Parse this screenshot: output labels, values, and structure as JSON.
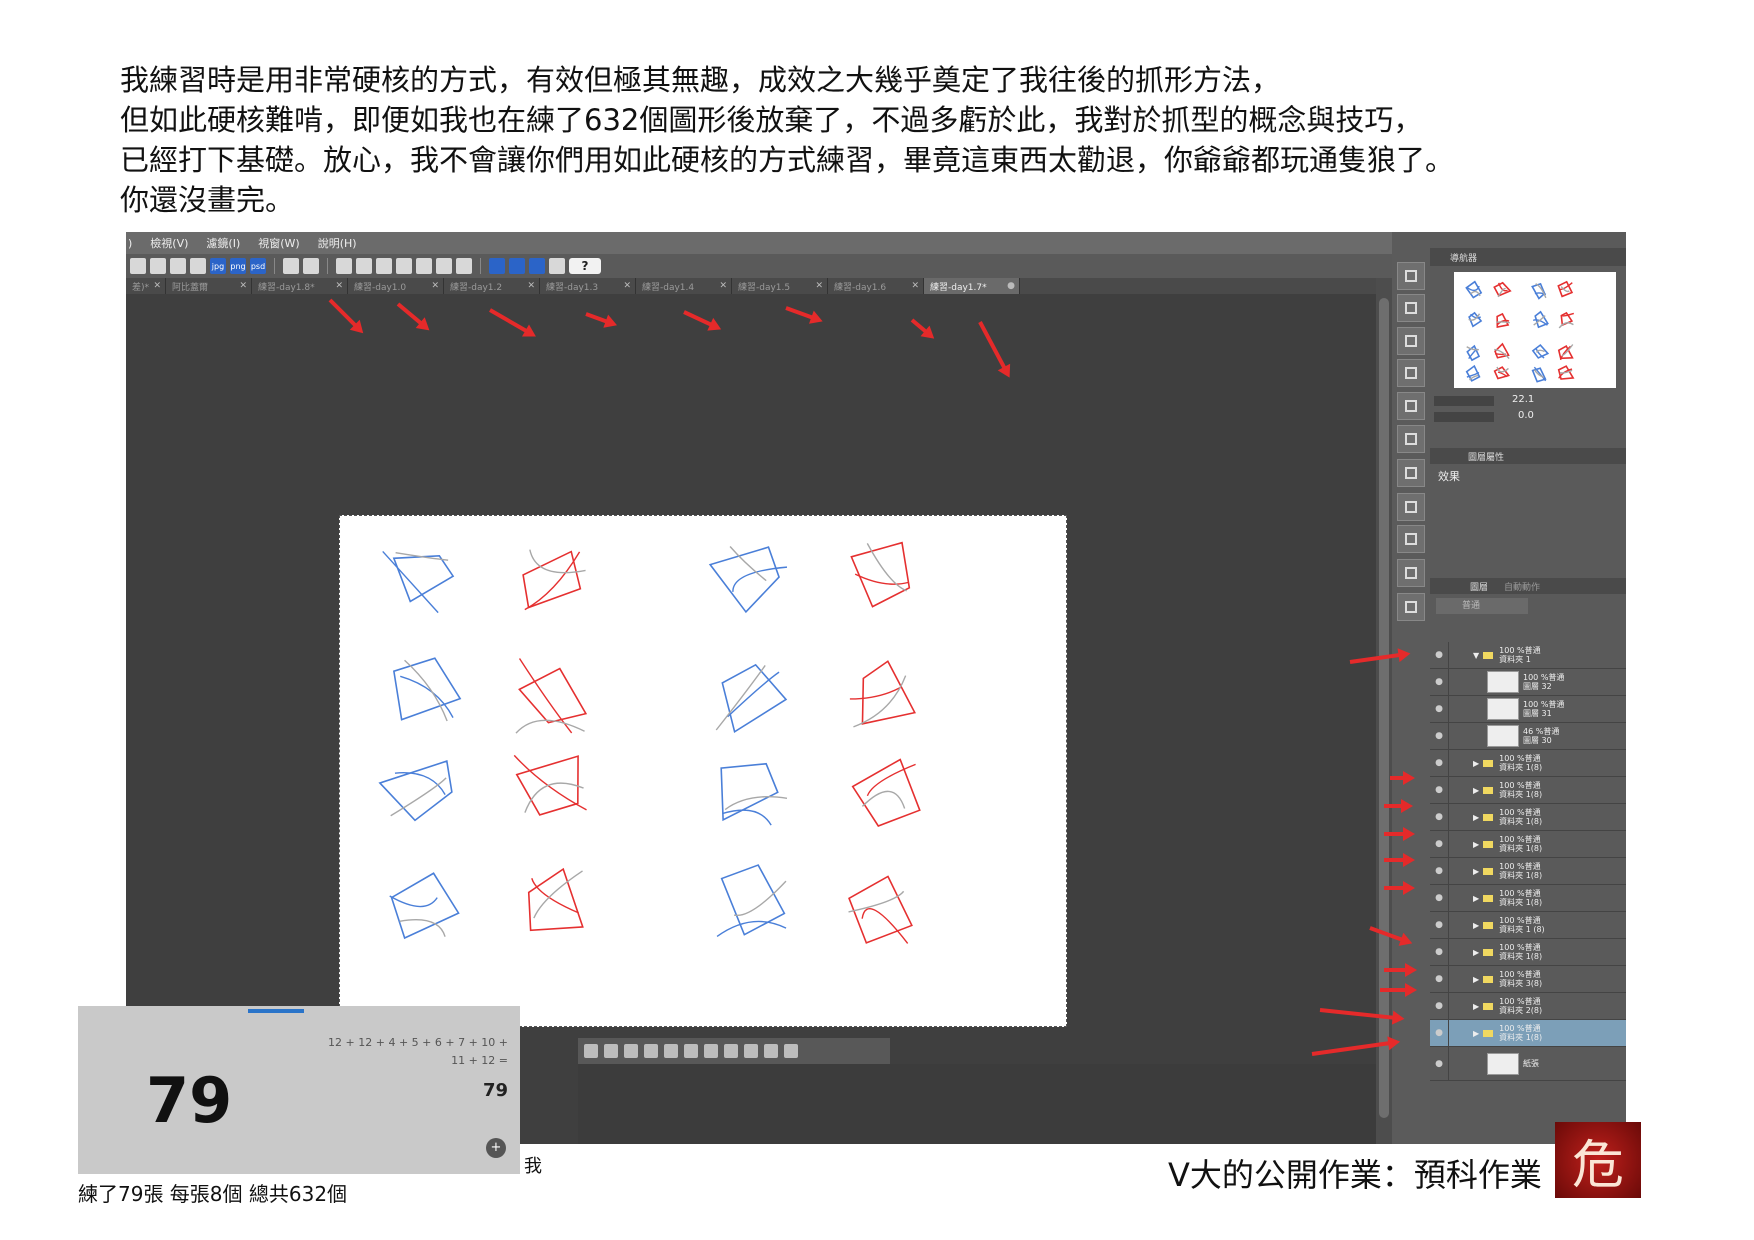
{
  "intro": {
    "line1": "我練習時是用非常硬核的方式，有效但極其無趣，成效之大幾乎奠定了我往後的抓形方法，",
    "line2": "但如此硬核難啃，即便如我也在練了632個圖形後放棄了，不過多虧於此，我對於抓型的概念與技巧，",
    "line3": "已經打下基礎。放心，我不會讓你們用如此硬核的方式練習，畢竟這東西太勸退，你爺爺都玩通隻狼了。",
    "line4": "你還沒畫完。"
  },
  "menu": [
    ")",
    "檢視(V)",
    "濾鏡(I)",
    "視窗(W)",
    "說明(H)"
  ],
  "toolbar_labels": {
    "jpg": "jpg",
    "png": "png",
    "psd": "psd",
    "help": "?"
  },
  "tabs": [
    {
      "label": "差)*",
      "active": false
    },
    {
      "label": "阿比蓋爾",
      "active": false
    },
    {
      "label": "練習-day1.8*",
      "active": false
    },
    {
      "label": "練習-day1.0",
      "active": false
    },
    {
      "label": "練習-day1.2",
      "active": false
    },
    {
      "label": "練習-day1.3",
      "active": false
    },
    {
      "label": "練習-day1.4",
      "active": false
    },
    {
      "label": "練習-day1.5",
      "active": false
    },
    {
      "label": "練習-day1.6",
      "active": false
    },
    {
      "label": "練習-day1.7*",
      "active": true
    }
  ],
  "navigator": {
    "tab": "導航器",
    "zoom": "22.1",
    "angle": "0.0"
  },
  "properties": {
    "tab": "圖層屬性",
    "effect_label": "效果"
  },
  "layers_panel": {
    "tab1": "圖層",
    "tab2": "自動動作",
    "blend": "普通",
    "rows": [
      {
        "l1": "100 %普通",
        "l2": "資料夾 1",
        "type": "folder-open",
        "sel": false
      },
      {
        "l1": "100 %普通",
        "l2": "圖層 32",
        "type": "layer",
        "sel": false
      },
      {
        "l1": "100 %普通",
        "l2": "圖層 31",
        "type": "layer",
        "sel": false
      },
      {
        "l1": "46 %普通",
        "l2": "圖層 30",
        "type": "layer",
        "sel": false
      },
      {
        "l1": "100 %普通",
        "l2": "資料夾 1(8)",
        "type": "folder",
        "sel": false
      },
      {
        "l1": "100 %普通",
        "l2": "資料夾 1(8)",
        "type": "folder",
        "sel": false
      },
      {
        "l1": "100 %普通",
        "l2": "資料夾 1(8)",
        "type": "folder",
        "sel": false
      },
      {
        "l1": "100 %普通",
        "l2": "資料夾 1(8)",
        "type": "folder",
        "sel": false
      },
      {
        "l1": "100 %普通",
        "l2": "資料夾 1(8)",
        "type": "folder",
        "sel": false
      },
      {
        "l1": "100 %普通",
        "l2": "資料夾 1(8)",
        "type": "folder",
        "sel": false
      },
      {
        "l1": "100 %普通",
        "l2": "資料夾 1 (8)",
        "type": "folder",
        "sel": false
      },
      {
        "l1": "100 %普通",
        "l2": "資料夾 1(8)",
        "type": "folder",
        "sel": false
      },
      {
        "l1": "100 %普通",
        "l2": "資料夾 3(8)",
        "type": "folder",
        "sel": false
      },
      {
        "l1": "100 %普通",
        "l2": "資料夾 2(8)",
        "type": "folder",
        "sel": false
      },
      {
        "l1": "100 %普通",
        "l2": "資料夾 1(8)",
        "type": "folder",
        "sel": true
      },
      {
        "l1": "紙張",
        "l2": "",
        "type": "paper",
        "sel": false
      }
    ]
  },
  "calculator": {
    "expr_line1": "12 + 12 + 4 + 5 + 6 + 7 + 10 +",
    "expr_line2": "11 + 12 =",
    "result": "79",
    "display": "79"
  },
  "side_note": "我",
  "caption": "練了79張 每張8個 總共632個",
  "footer": "V大的公開作業：預科作業",
  "logo_char": "危",
  "colors": {
    "accent_arrow": "#e52a2a",
    "sketch_blue": "#4a7fd8",
    "sketch_red": "#e53030",
    "sketch_gray": "#a8a8a8"
  }
}
